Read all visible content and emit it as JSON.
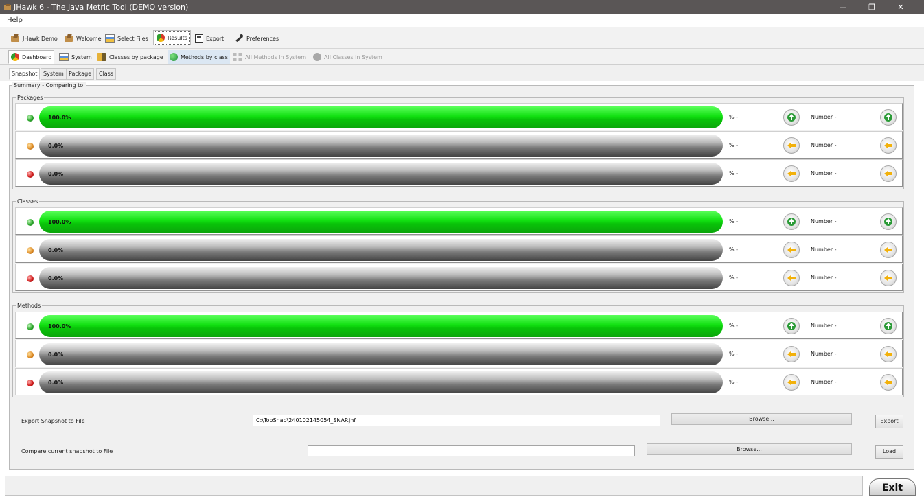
{
  "window": {
    "title": "JHawk 6 - The Java Metric Tool (DEMO version)",
    "controls": {
      "minimize": "—",
      "restore": "❐",
      "close": "✕"
    }
  },
  "menu": {
    "help": "Help"
  },
  "toolbar": {
    "items": [
      {
        "label": "JHawk Demo",
        "icon": "folder-icon"
      },
      {
        "label": "Welcome",
        "icon": "folder-icon"
      },
      {
        "label": "Select Files",
        "icon": "system-icon"
      },
      {
        "label": "Results",
        "icon": "pie-chart-icon",
        "selected": true
      },
      {
        "label": "Export",
        "icon": "disk-icon"
      },
      {
        "label": "Preferences",
        "icon": "tool-icon"
      }
    ]
  },
  "tabs": [
    {
      "label": "Dashboard",
      "state": "active"
    },
    {
      "label": "System",
      "state": "normal"
    },
    {
      "label": "Classes by package",
      "state": "normal"
    },
    {
      "label": "Methods by class",
      "state": "hover"
    },
    {
      "label": "All Methods In System",
      "state": "disabled"
    },
    {
      "label": "All Classes in System",
      "state": "disabled"
    }
  ],
  "subtabs": [
    {
      "label": "Snapshot",
      "active": true
    },
    {
      "label": "System"
    },
    {
      "label": "Package"
    },
    {
      "label": "Class"
    }
  ],
  "summary": {
    "legend": "Summary - Comparing to:",
    "sections": [
      {
        "title": "Packages",
        "rows": [
          {
            "status": "green",
            "bar_text": "100.0%",
            "fill": 1.0,
            "pct": "% -",
            "number": "Number -",
            "arrow": "up"
          },
          {
            "status": "orange",
            "bar_text": "0.0%",
            "fill": 0.0,
            "pct": "% -",
            "number": "Number -",
            "arrow": "left"
          },
          {
            "status": "red",
            "bar_text": "0.0%",
            "fill": 0.0,
            "pct": "% -",
            "number": "Number -",
            "arrow": "left"
          }
        ]
      },
      {
        "title": "Classes",
        "rows": [
          {
            "status": "green",
            "bar_text": "100.0%",
            "fill": 1.0,
            "pct": "% -",
            "number": "Number -",
            "arrow": "up"
          },
          {
            "status": "orange",
            "bar_text": "0.0%",
            "fill": 0.0,
            "pct": "% -",
            "number": "Number -",
            "arrow": "left"
          },
          {
            "status": "red",
            "bar_text": "0.0%",
            "fill": 0.0,
            "pct": "% -",
            "number": "Number -",
            "arrow": "left"
          }
        ]
      },
      {
        "title": "Methods",
        "rows": [
          {
            "status": "green",
            "bar_text": "100.0%",
            "fill": 1.0,
            "pct": "% -",
            "number": "Number -",
            "arrow": "up"
          },
          {
            "status": "orange",
            "bar_text": "0.0%",
            "fill": 0.0,
            "pct": "% -",
            "number": "Number -",
            "arrow": "left"
          },
          {
            "status": "red",
            "bar_text": "0.0%",
            "fill": 0.0,
            "pct": "% -",
            "number": "Number -",
            "arrow": "left"
          }
        ]
      }
    ]
  },
  "export_snapshot": {
    "label": "Export Snapshot to File",
    "value": "C:\\TopSnap\\240102145054_SNAP.jhf",
    "browse": "Browse...",
    "button": "Export"
  },
  "compare_snapshot": {
    "label": "Compare current snapshot to File",
    "value": "",
    "browse": "Browse...",
    "button": "Load"
  },
  "exit_button": "Exit",
  "colors": {
    "green_bar": "#11e011",
    "gray_bar": "#7a7a7a",
    "status_green": "#2ea82e",
    "status_orange": "#e0902a",
    "status_red": "#d42020",
    "arrow_up": "#2a9a36",
    "arrow_left": "#f2b10b"
  }
}
